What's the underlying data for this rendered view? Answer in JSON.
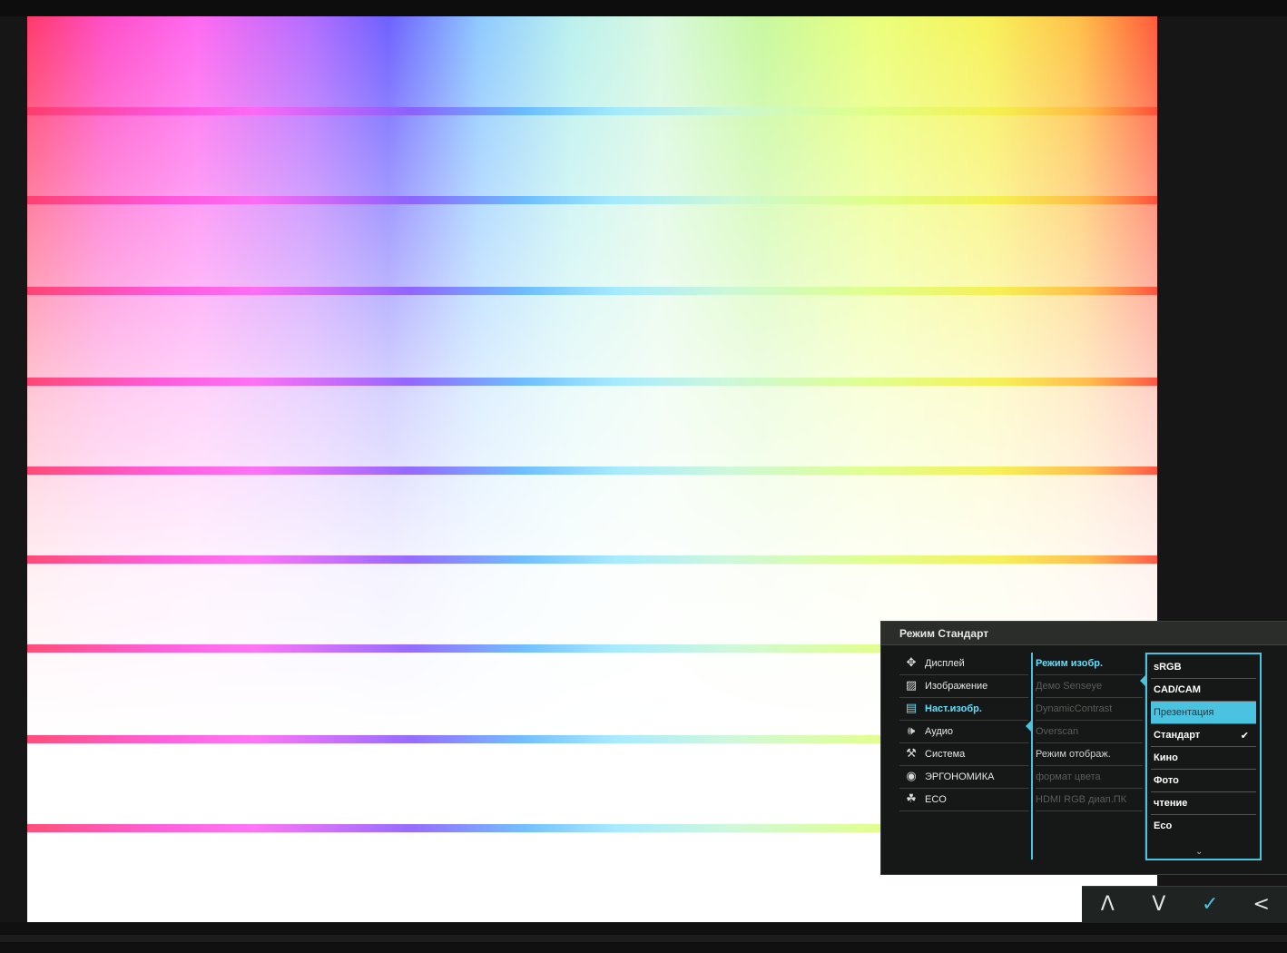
{
  "osd": {
    "title": "Режим Стандарт",
    "main_menu": [
      {
        "icon": "display-icon",
        "glyph": "✥",
        "label": "Дисплей"
      },
      {
        "icon": "picture-icon",
        "glyph": "▨",
        "label": "Изображение"
      },
      {
        "icon": "picture-advanced-icon",
        "glyph": "▤",
        "label": "Наст.изобр."
      },
      {
        "icon": "audio-icon",
        "glyph": "🕪",
        "label": "Аудио"
      },
      {
        "icon": "wrench-icon",
        "glyph": "⚒",
        "label": "Система"
      },
      {
        "icon": "eye-icon",
        "glyph": "◉",
        "label": "ЭРГОНОМИКА"
      },
      {
        "icon": "leaf-icon",
        "glyph": "☘",
        "label": "ECO"
      }
    ],
    "submenu": [
      {
        "label": "Режим изобр."
      },
      {
        "label": "Демо Senseye"
      },
      {
        "label": "DynamicContrast"
      },
      {
        "label": "Overscan"
      },
      {
        "label": "Режим отображ."
      },
      {
        "label": "формат цвета"
      },
      {
        "label": "HDMI RGB диап.ПК"
      }
    ],
    "options": [
      {
        "label": "sRGB"
      },
      {
        "label": "CAD/CAM"
      },
      {
        "label": "Презентация"
      },
      {
        "label": "Стандарт",
        "check": "✔"
      },
      {
        "label": "Кино"
      },
      {
        "label": "Фото"
      },
      {
        "label": "чтение"
      },
      {
        "label": "Eco"
      }
    ],
    "more_glyph": "⌄"
  },
  "keys": {
    "up": "Λ",
    "down": "V",
    "ok": "✓",
    "back": "<"
  },
  "colors": {
    "accent": "#49c3e0",
    "osd_bg": "#151816"
  }
}
